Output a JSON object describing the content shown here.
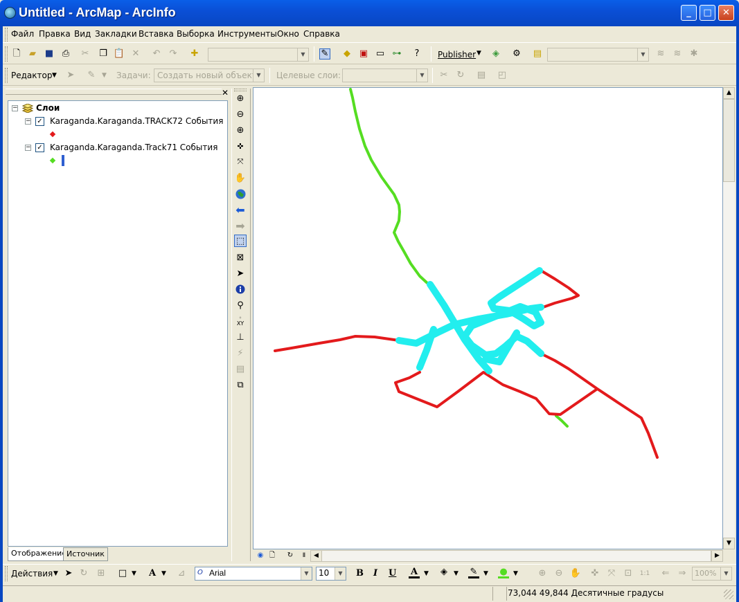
{
  "window": {
    "title": "Untitled - ArcMap - ArcInfo"
  },
  "menu": {
    "items": [
      "Файл",
      "Правка",
      "Вид",
      "Закладки",
      "Вставка",
      "Выборка",
      "Инструменты",
      "Окно",
      "Справка"
    ]
  },
  "standard_toolbar": {
    "publisher_label": "Publisher"
  },
  "editor_toolbar": {
    "editor_label": "Редактор",
    "tasks_label": "Задачи:",
    "tasks_value": "Создать новый объект",
    "target_label": "Целевые слои:"
  },
  "toc": {
    "root_label": "Слои",
    "layers": [
      {
        "name": "Karaganda.Karaganda.TRACK72 События",
        "checked": true,
        "symbol_color": "#e31a1c"
      },
      {
        "name": "Karaganda.Karaganda.Track71 События",
        "checked": true,
        "symbol_color": "#55dd22"
      }
    ],
    "tabs": [
      "Отображение",
      "Источник"
    ]
  },
  "drawing_toolbar": {
    "actions_label": "Действия",
    "font_name": "Arial",
    "font_size": "10",
    "bold": "B",
    "italic": "I",
    "underline": "U",
    "zoom_value": "100%"
  },
  "status": {
    "coordinates": "73,044  49,844 Десятичные градусы"
  },
  "map_colors": {
    "red_track": "#e31a1c",
    "green_track": "#55dd22",
    "cyan_track": "#22eeee"
  }
}
